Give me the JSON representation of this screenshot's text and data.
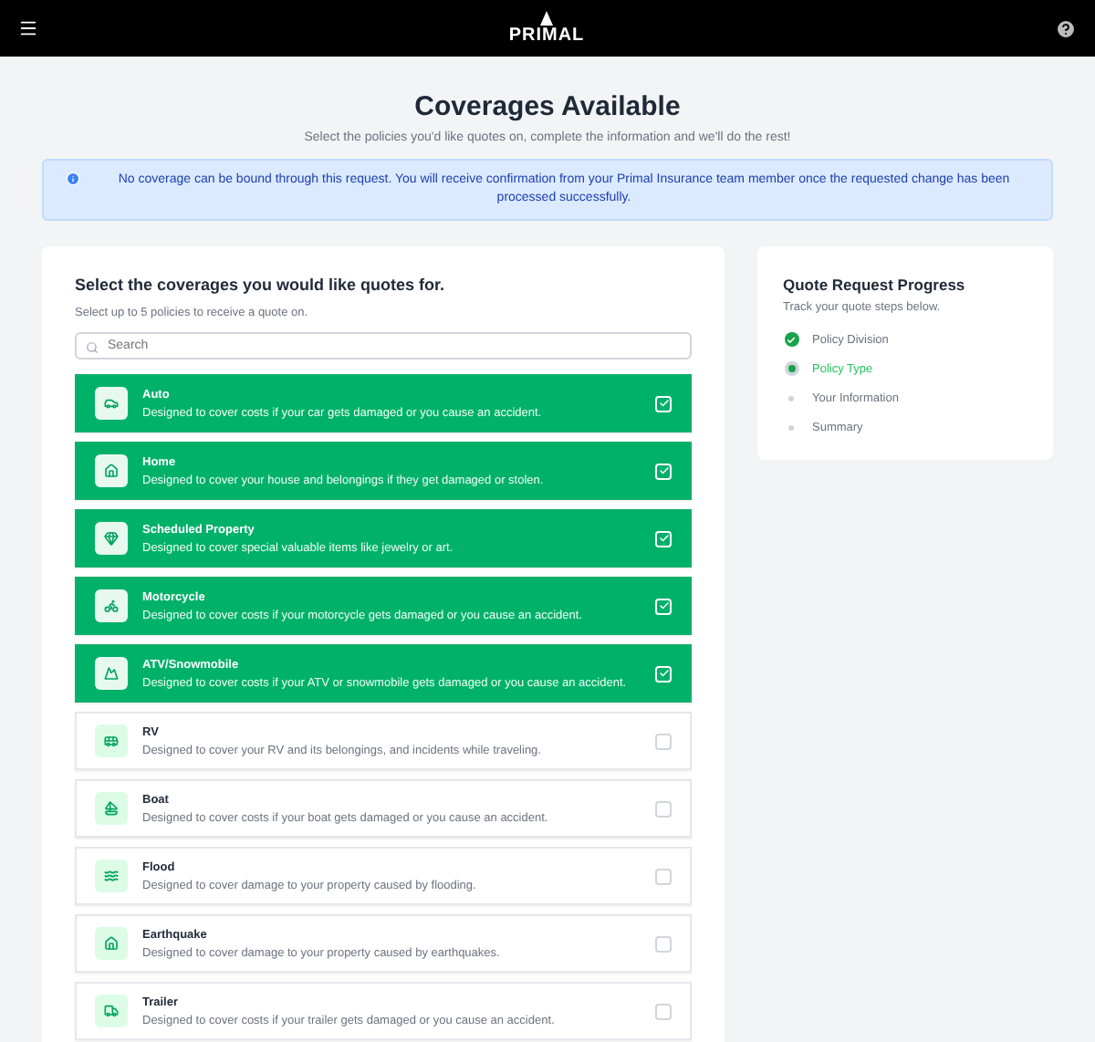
{
  "header": {
    "logo": "PRIMAL"
  },
  "page": {
    "title": "Coverages Available",
    "subtitle": "Select the policies you'd like quotes on, complete the information and we'll do the rest!"
  },
  "notice": {
    "text": "No coverage can be bound through this request. You will receive confirmation from your Primal Insurance team member once the requested change has been processed successfully."
  },
  "coverage_panel": {
    "heading": "Select the coverages you would like quotes for.",
    "hint": "Select up to 5 policies to receive a quote on.",
    "search": {
      "placeholder": "Search"
    },
    "items": [
      {
        "name": "Auto",
        "description": "Designed to cover costs if your car gets damaged or you cause an accident.",
        "selected": true
      },
      {
        "name": "Home",
        "description": "Designed to cover your house and belongings if they get damaged or stolen.",
        "selected": true
      },
      {
        "name": "Scheduled Property",
        "description": "Designed to cover special valuable items like jewelry or art.",
        "selected": true
      },
      {
        "name": "Motorcycle",
        "description": "Designed to cover costs if your motorcycle gets damaged or you cause an accident.",
        "selected": true
      },
      {
        "name": "ATV/Snowmobile",
        "description": "Designed to cover costs if your ATV or snowmobile gets damaged or you cause an accident.",
        "selected": true
      },
      {
        "name": "RV",
        "description": "Designed to cover your RV and its belongings, and incidents while traveling.",
        "selected": false
      },
      {
        "name": "Boat",
        "description": "Designed to cover costs if your boat gets damaged or you cause an accident.",
        "selected": false
      },
      {
        "name": "Flood",
        "description": "Designed to cover damage to your property caused by flooding.",
        "selected": false
      },
      {
        "name": "Earthquake",
        "description": "Designed to cover damage to your property caused by earthquakes.",
        "selected": false
      },
      {
        "name": "Trailer",
        "description": "Designed to cover costs if your trailer gets damaged or you cause an accident.",
        "selected": false
      }
    ]
  },
  "progress": {
    "title": "Quote Request Progress",
    "subtitle": "Track your quote steps below.",
    "steps": [
      {
        "label": "Policy Division",
        "kind": "done"
      },
      {
        "label": "Policy Type",
        "kind": "current"
      },
      {
        "label": "Your Information",
        "kind": "pending"
      },
      {
        "label": "Summary",
        "kind": "pending"
      }
    ]
  }
}
